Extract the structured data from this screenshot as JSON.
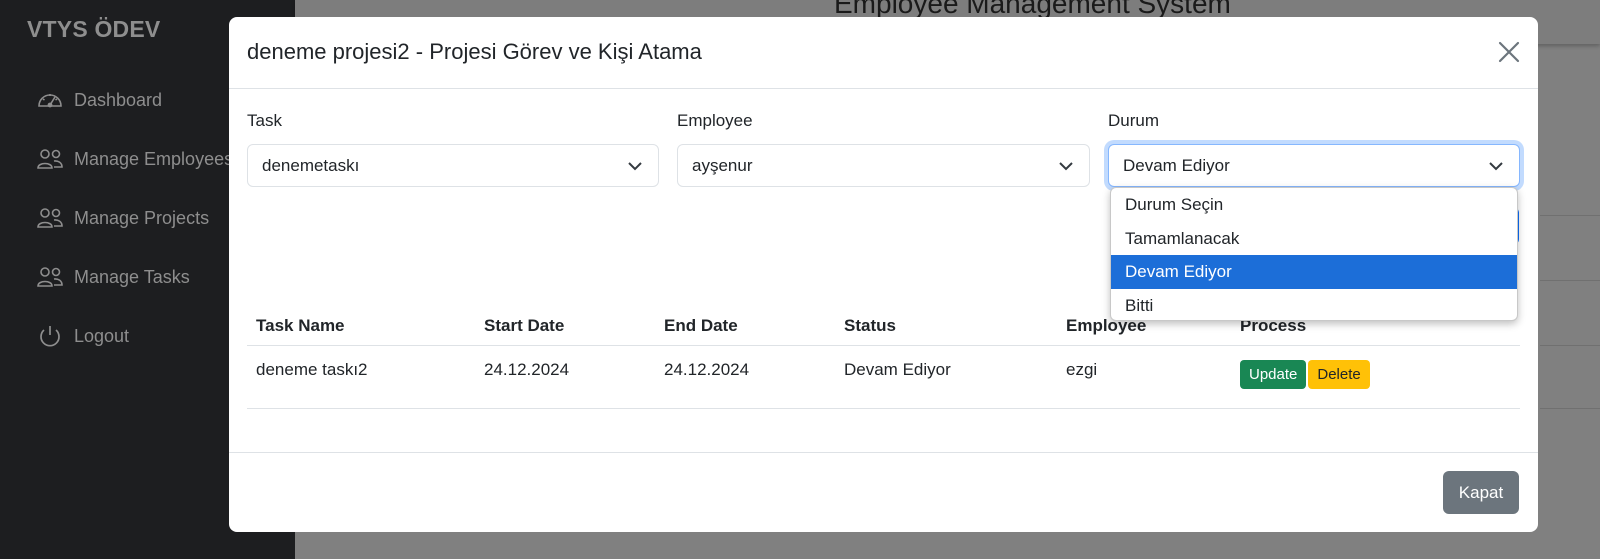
{
  "sidebar": {
    "brand": "VTYS ÖDEV",
    "items": [
      {
        "label": "Dashboard",
        "icon": "speedometer-icon"
      },
      {
        "label": "Manage Employees",
        "icon": "people-icon"
      },
      {
        "label": "Manage Projects",
        "icon": "people-icon"
      },
      {
        "label": "Manage Tasks",
        "icon": "people-icon"
      },
      {
        "label": "Logout",
        "icon": "power-icon"
      }
    ]
  },
  "background": {
    "page_title": "Employee Management System"
  },
  "modal": {
    "title": "deneme projesi2 - Projesi Görev ve Kişi Atama",
    "fields": {
      "task": {
        "label": "Task",
        "value": "denemetaskı"
      },
      "employee": {
        "label": "Employee",
        "value": "ayşenur"
      },
      "status": {
        "label": "Durum",
        "value": "Devam Ediyor",
        "options": [
          "Durum Seçin",
          "Tamamlanacak",
          "Devam Ediyor",
          "Bitti"
        ],
        "selected_index": 2
      }
    },
    "table": {
      "headers": [
        "Task Name",
        "Start Date",
        "End Date",
        "Status",
        "Employee",
        "Process"
      ],
      "rows": [
        {
          "task_name": "deneme taskı2",
          "start_date": "24.12.2024",
          "end_date": "24.12.2024",
          "status": "Devam Ediyor",
          "employee": "ezgi",
          "update_label": "Update",
          "delete_label": "Delete"
        }
      ]
    },
    "footer": {
      "close_label": "Kapat"
    }
  },
  "colors": {
    "update": "#198754",
    "delete": "#ffc107",
    "selected_option": "#1c6ed8",
    "close_button": "#6c757d"
  }
}
